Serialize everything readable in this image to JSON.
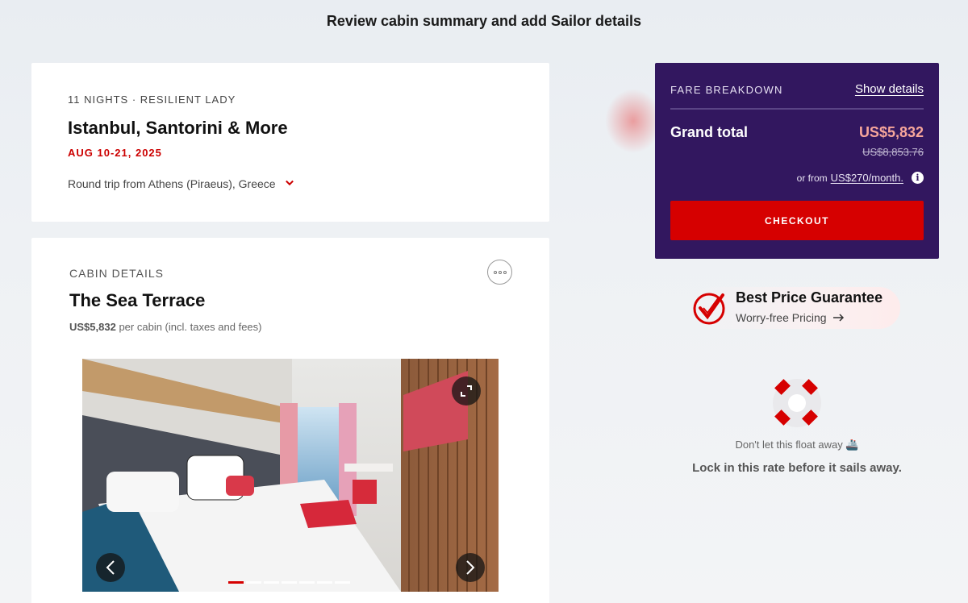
{
  "page": {
    "title": "Review cabin summary and add Sailor details"
  },
  "trip": {
    "meta": "11 NIGHTS · RESILIENT LADY",
    "title": "Istanbul, Santorini & More",
    "dates": "AUG 10-21, 2025",
    "route": "Round trip from Athens (Piraeus), Greece"
  },
  "cabin": {
    "label": "CABIN DETAILS",
    "title": "The Sea Terrace",
    "price": "US$5,832",
    "price_note": "per cabin (incl. taxes and fees)",
    "gallery": {
      "slide_count": 7,
      "active_slide": 1
    }
  },
  "fare": {
    "label": "FARE BREAKDOWN",
    "show_details": "Show details",
    "grand_label": "Grand total",
    "grand_total": "US$5,832",
    "original_total": "US$8,853.76",
    "monthly_prefix": "or from",
    "monthly_amount": "US$270/month.",
    "checkout_label": "CHECKOUT"
  },
  "guarantee": {
    "title": "Best Price Guarantee",
    "subtitle": "Worry-free Pricing"
  },
  "float": {
    "subtitle": "Don't let this float away 🚢",
    "message": "Lock in this rate before it sails away."
  },
  "colors": {
    "accent_red": "#d60000",
    "fare_bg": "#32175f",
    "total_pink": "#f7a69b"
  },
  "icons": [
    "chevron-down-icon",
    "more-icon",
    "expand-icon",
    "arrow-left-icon",
    "arrow-right-icon",
    "info-icon",
    "check-badge-icon",
    "arrow-right-small-icon",
    "life-ring-icon"
  ]
}
